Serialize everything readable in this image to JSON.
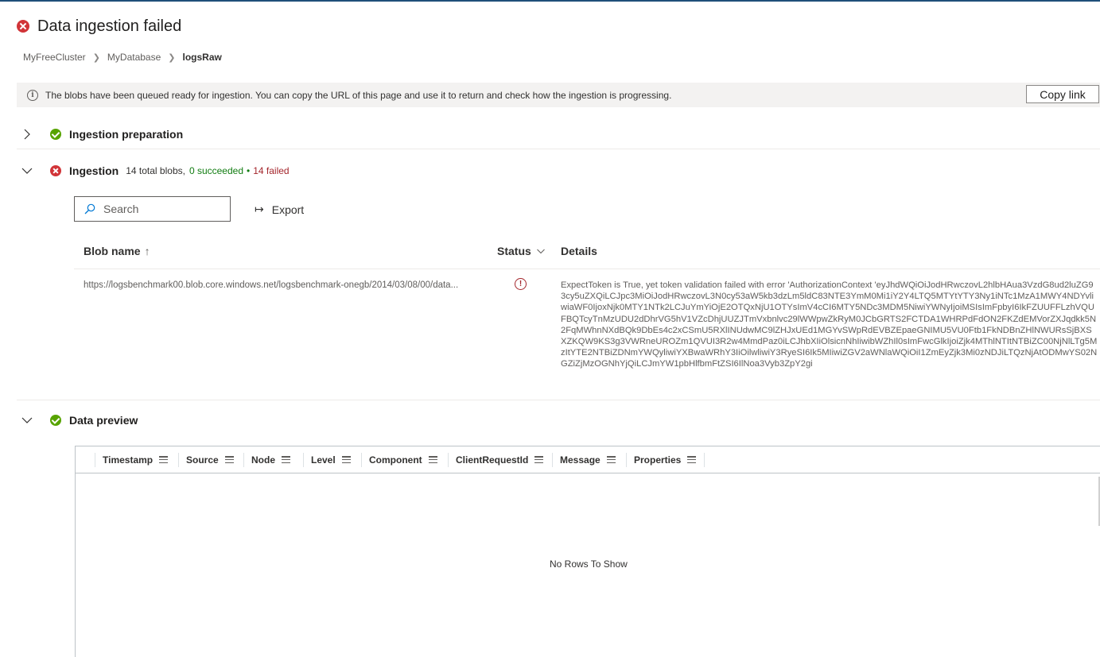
{
  "header": {
    "title": "Data ingestion failed"
  },
  "breadcrumb": {
    "items": [
      "MyFreeCluster",
      "MyDatabase",
      "logsRaw"
    ]
  },
  "infobar": {
    "message": "The blobs have been queued ready for ingestion. You can copy the URL of this page and use it to return and check how the ingestion is progressing.",
    "copy_label": "Copy link"
  },
  "sections": {
    "preparation": {
      "title": "Ingestion preparation",
      "status": "success",
      "expanded": false
    },
    "ingestion": {
      "title": "Ingestion",
      "total": "14 total blobs,",
      "succeeded": "0 succeeded",
      "separator": "•",
      "failed": "14 failed",
      "status": "error",
      "expanded": true
    },
    "preview": {
      "title": "Data preview",
      "status": "success",
      "expanded": true
    }
  },
  "toolbar": {
    "search_placeholder": "Search",
    "export_label": "Export"
  },
  "blob_table": {
    "columns": {
      "name": "Blob name",
      "name_sort": "↑",
      "status": "Status",
      "details": "Details"
    },
    "rows": [
      {
        "name": "https://logsbenchmark00.blob.core.windows.net/logsbenchmark-onegb/2014/03/08/00/data...",
        "status": "error",
        "details": "ExpectToken is True, yet token validation failed with error 'AuthorizationContext 'eyJhdWQiOiJodHRwczovL2hlbHAua3VzdG8ud2luZG93cy5uZXQiLCJpc3MiOiJodHRwczovL3N0cy53aW5kb3dzLm5ldC83NTE3YmM0Mi1iY2Y4LTQ5MTYtYTY3Ny1iNTc1MzA1MWY4NDYvliwiaWF0IjoxNjk0MTY1NTk2LCJuYmYiOjE2OTQxNjU1OTYsImV4cCI6MTY5NDc3MDM5NiwiYWNyIjoiMSIsImFpbyI6IkFZUUFFLzhVQUFBQTcyTnMzUDU2dDhrVG5hV1VZcDhjUUZJTmVxbnlvc29lWWpwZkRyM0JCbGRTS2FCTDA1WHRPdFdON2FKZdEMVorZXJqdkk5N2FqMWhnNXdBQk9DbEs4c2xCSmU5RXlINUdwMC9lZHJxUEd1MGYvSWpRdEVBZEpaeGNIMU5VU0Ftb1FkNDBnZHlNWURsSjBXSXZKQW9KS3g3VWRneUROZm1QVUI3R2w4MmdPaz0iLCJhbXIiOlsicnNhIiwibWZhIl0sImFwcGlkIjoiZjk4MThlNTItNTBiZC00NjNlLTg5MzItYTE2NTBiZDNmYWQyliwiYXBwaWRhY3IiOilwliwiY3RyeSI6Ik5MIiwiZGV2aWNlaWQiOiI1ZmEyZjk3Mi0zNDJiLTQzNjAtODMwYS02NGZiZjMzOGNhYjQiLCJmYW1pbHlfbmFtZSI6IlNoa3Vyb3ZpY2gi"
      }
    ]
  },
  "grid": {
    "columns": [
      "Timestamp",
      "Source",
      "Node",
      "Level",
      "Component",
      "ClientRequestId",
      "Message",
      "Properties"
    ],
    "empty_text": "No Rows To Show"
  }
}
